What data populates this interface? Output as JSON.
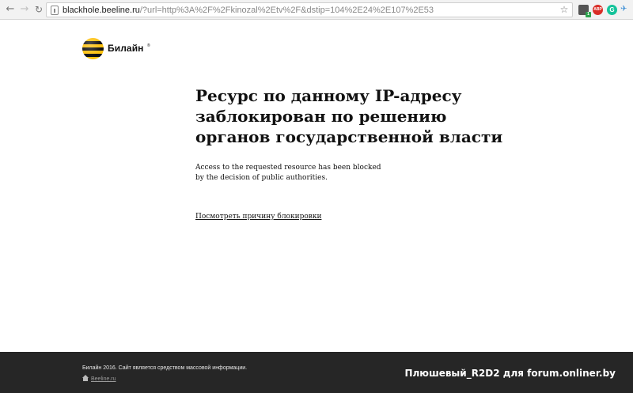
{
  "browser": {
    "url_host": "blackhole.beeline.ru",
    "url_rest": "/?url=http%3A%2F%2Fkinozal%2Etv%2F&dstip=104%2E24%2E107%2E53",
    "extensions": {
      "badge_1": "1",
      "abp_label": "ABP",
      "g_label": "G"
    },
    "icons": {
      "back": "←",
      "forward": "→",
      "reload": "↻",
      "star": "☆",
      "bird": "✈"
    }
  },
  "brand": {
    "name": "Билайн",
    "tm": "®",
    "colors": {
      "yellow": "#fec10e",
      "black": "#111111"
    }
  },
  "main": {
    "headline_lines": [
      "Ресурс по данному IP-адресу",
      "заблокирован по решению",
      "органов государственной власти"
    ],
    "subtext_lines": [
      "Access to the requested resource has been blocked",
      "by the decision of public authorities."
    ],
    "reason_link": "Посмотреть причину блокировки"
  },
  "footer": {
    "text": "Билайн 2016. Сайт является средством массовой информации.",
    "link": "Beeline.ru",
    "background": "#262626",
    "watermark": "Плюшевый_R2D2 для forum.onliner.by"
  }
}
